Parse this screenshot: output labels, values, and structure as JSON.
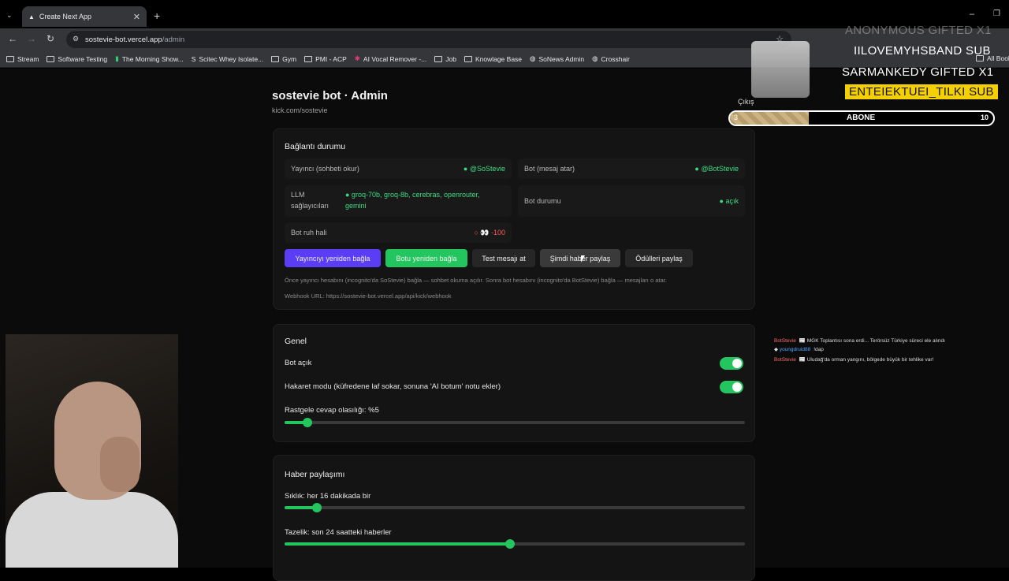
{
  "browser": {
    "tab_title": "Create Next App",
    "url_host": "sostevie-bot.vercel.app",
    "url_path": "/admin",
    "bookmarks": [
      "Stream",
      "Software Testing",
      "The Morning Show...",
      "Scitec Whey Isolate...",
      "Gym",
      "PMI - ACP",
      "AI Vocal Remover -...",
      "Job",
      "Knowlage Base",
      "SoNews Admin",
      "Crosshair"
    ],
    "all_bookmarks": "All Book"
  },
  "header": {
    "title": "sostevie bot · Admin",
    "subtitle": "kick.com/sostevie",
    "logout": "Çıkış"
  },
  "connection": {
    "title": "Bağlantı durumu",
    "streamer_label": "Yayıncı (sohbeti okur)",
    "streamer_value": "● @SoStevie",
    "bot_label": "Bot (mesaj atar)",
    "bot_value": "● @BotStevie",
    "llm_label_1": "LLM",
    "llm_label_2": "sağlayıcıları",
    "llm_value_1": "● groq-70b, groq-8b, cerebras, openrouter,",
    "llm_value_2": "gemini",
    "botstate_label": "Bot durumu",
    "botstate_value": "● açık",
    "mood_label": "Bot ruh hali",
    "mood_value": "○ 👀 -100",
    "buttons": [
      "Yayıncıyı yeniden bağla",
      "Botu yeniden bağla",
      "Test mesajı at",
      "Şimdi haber paylaş",
      "Ödülleri paylaş"
    ],
    "note": "Önce yayıncı hesabını (incognito'da SoStevie) bağla — sohbet okuma açılır. Sonra bot hesabını (incognito'da BotStevie) bağla — mesajları o atar.",
    "webhook": "Webhook URL: https://sostevie-bot.vercel.app/api/kick/webhook"
  },
  "general": {
    "title": "Genel",
    "bot_on": "Bot açık",
    "insult_mode": "Hakaret modu (küfredene laf sokar, sonuna 'AI botum' notu ekler)",
    "random_reply": "Rastgele cevap olasılığı: %5",
    "random_reply_fraction": 0.05
  },
  "news": {
    "title": "Haber paylaşımı",
    "frequency": "Sıklık: her 16 dakikada bir",
    "frequency_fraction": 0.07,
    "freshness": "Tazelik: son 24 saatteki haberler",
    "freshness_fraction": 0.49
  },
  "overlay": {
    "line1": "ANONYMOUS  GIFTED X1",
    "line2": "IILOVEMYHSBAND  SUB",
    "line3": "SARMANKEDY  GIFTED X1",
    "line4": "ENTEIEKTUEI_TILKI  SUB",
    "goal_current": "3",
    "goal_label": "ABONE",
    "goal_target": "10",
    "goal_fraction": 0.3
  },
  "chat": [
    {
      "user": "BotStevie",
      "text": "📰 MGK Toplantısı sona erdi... Terörsüz Türkiye süreci ele alındı"
    },
    {
      "user": "youngdruid88",
      "text": "!dap"
    },
    {
      "user": "BotStevie",
      "text": "📰 Uludağ'da orman yangını, bölgede büyük bir tehlike var!"
    }
  ],
  "colors": {
    "accent_green": "#22c55e",
    "accent_purple": "#5b3df5",
    "overlay_yellow": "#f5d000"
  }
}
